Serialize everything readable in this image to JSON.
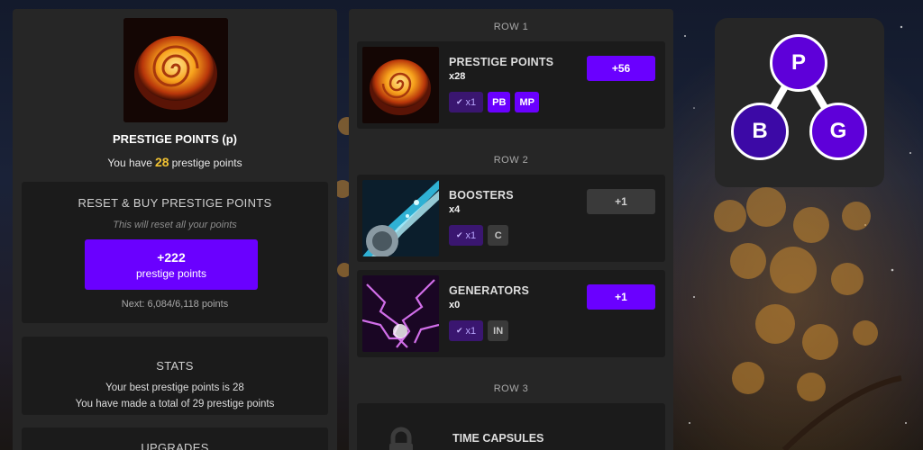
{
  "colors": {
    "accent": "#6a00ff",
    "gold": "#f1c232",
    "panel": "#262626",
    "card": "#1b1b1b"
  },
  "left": {
    "title": "PRESTIGE POINTS (p)",
    "have_prefix": "You have",
    "amount": "28",
    "have_suffix": "prestige points",
    "reset": {
      "title": "RESET & BUY PRESTIGE POINTS",
      "desc": "This will reset all your points",
      "btn_amount": "+222",
      "btn_label": "prestige points",
      "next": "Next: 6,084/6,118 points"
    },
    "stats": {
      "title": "STATS",
      "line1": "Your best prestige points is 28",
      "line2": "You have made a total of 29 prestige points"
    },
    "upgrades": {
      "title": "UPGRADES"
    }
  },
  "middle": {
    "rows": [
      {
        "label": "ROW 1",
        "items": [
          {
            "name": "PRESTIGE POINTS",
            "count": "x28",
            "button": "+56",
            "button_state": "active",
            "check": "x1",
            "chips": [
              {
                "text": "PB",
                "state": "on"
              },
              {
                "text": "MP",
                "state": "on"
              }
            ],
            "icon": "spiral-disc-icon"
          }
        ]
      },
      {
        "label": "ROW 2",
        "items": [
          {
            "name": "BOOSTERS",
            "count": "x4",
            "button": "+1",
            "button_state": "disabled",
            "check": "x1",
            "chips": [
              {
                "text": "C",
                "state": "off"
              }
            ],
            "icon": "booster-beam-icon"
          },
          {
            "name": "GENERATORS",
            "count": "x0",
            "button": "+1",
            "button_state": "active",
            "check": "x1",
            "chips": [
              {
                "text": "IN",
                "state": "off"
              }
            ],
            "icon": "lightning-icon"
          }
        ]
      },
      {
        "label": "ROW 3",
        "locked_item": {
          "name": "TIME CAPSULES",
          "icon": "lock-icon"
        }
      }
    ]
  },
  "tree": {
    "nodes": [
      {
        "id": "p",
        "label": "P"
      },
      {
        "id": "b",
        "label": "B"
      },
      {
        "id": "g",
        "label": "G"
      }
    ]
  }
}
